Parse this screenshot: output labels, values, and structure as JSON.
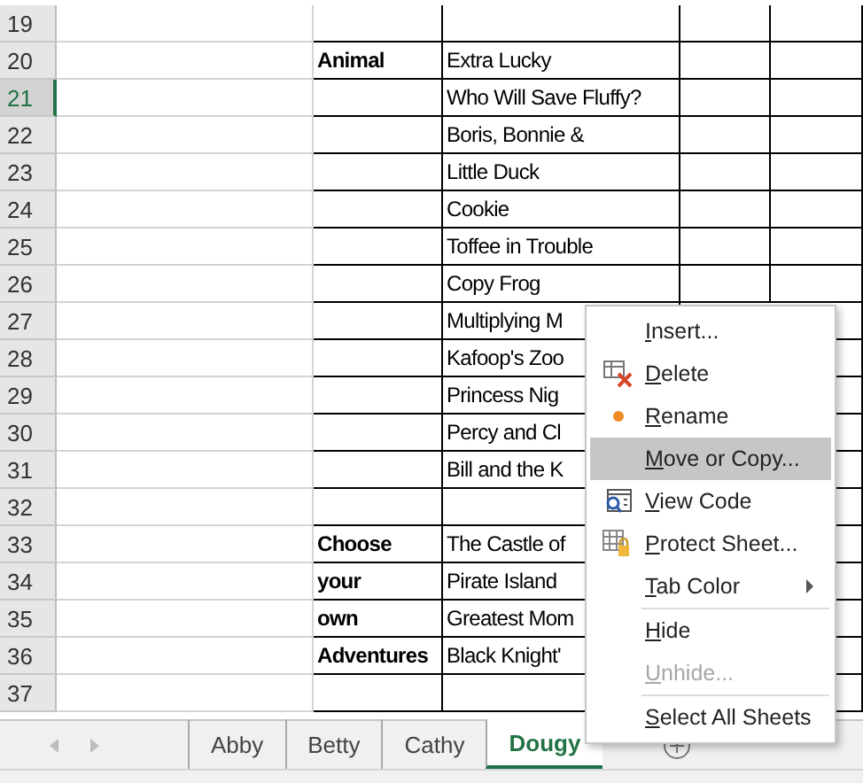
{
  "sheet": {
    "rows": [
      {
        "number": "19",
        "active": false,
        "cells": [
          "",
          "",
          "",
          "",
          ""
        ]
      },
      {
        "number": "20",
        "active": false,
        "cells": [
          "",
          "Animal",
          "Extra Lucky",
          "",
          ""
        ]
      },
      {
        "number": "21",
        "active": true,
        "cells": [
          "",
          "",
          "Who Will Save Fluffy?",
          "",
          ""
        ]
      },
      {
        "number": "22",
        "active": false,
        "cells": [
          "",
          "",
          "Boris, Bonnie &",
          "",
          ""
        ]
      },
      {
        "number": "23",
        "active": false,
        "cells": [
          "",
          "",
          "Little Duck",
          "",
          ""
        ]
      },
      {
        "number": "24",
        "active": false,
        "cells": [
          "",
          "",
          "Cookie",
          "",
          ""
        ]
      },
      {
        "number": "25",
        "active": false,
        "cells": [
          "",
          "",
          "Toffee in Trouble",
          "",
          ""
        ]
      },
      {
        "number": "26",
        "active": false,
        "cells": [
          "",
          "",
          "Copy Frog",
          "",
          ""
        ]
      },
      {
        "number": "27",
        "active": false,
        "cells": [
          "",
          "",
          "Multiplying M",
          "",
          ""
        ]
      },
      {
        "number": "28",
        "active": false,
        "cells": [
          "",
          "",
          "Kafoop's Zoo",
          "",
          ""
        ]
      },
      {
        "number": "29",
        "active": false,
        "cells": [
          "",
          "",
          "Princess Nig",
          "",
          ""
        ]
      },
      {
        "number": "30",
        "active": false,
        "cells": [
          "",
          "",
          "Percy and Cl",
          "",
          ""
        ]
      },
      {
        "number": "31",
        "active": false,
        "cells": [
          "",
          "",
          "Bill and the K",
          "",
          ""
        ]
      },
      {
        "number": "32",
        "active": false,
        "cells": [
          "",
          "",
          "",
          "",
          ""
        ]
      },
      {
        "number": "33",
        "active": false,
        "cells": [
          "",
          "Choose",
          "The Castle of",
          "",
          ""
        ]
      },
      {
        "number": "34",
        "active": false,
        "cells": [
          "",
          "your",
          "Pirate Island",
          "",
          ""
        ]
      },
      {
        "number": "35",
        "active": false,
        "cells": [
          "",
          "own",
          "Greatest Mom",
          "",
          ""
        ]
      },
      {
        "number": "36",
        "active": false,
        "cells": [
          "",
          "Adventures",
          "Black Knight'",
          "",
          ""
        ]
      },
      {
        "number": "37",
        "active": false,
        "cells": [
          "",
          "",
          "",
          "",
          ""
        ]
      }
    ]
  },
  "sheet_tabs": [
    {
      "label": "Abby",
      "selected": false
    },
    {
      "label": "Betty",
      "selected": false
    },
    {
      "label": "Cathy",
      "selected": false
    },
    {
      "label": "Dougy",
      "selected": true
    }
  ],
  "context_menu": [
    {
      "kind": "item",
      "label": "Insert...",
      "highlighted": false,
      "disabled": false
    },
    {
      "kind": "item",
      "label": "Delete",
      "highlighted": false,
      "disabled": false
    },
    {
      "kind": "item",
      "label": "Rename",
      "highlighted": false,
      "disabled": false
    },
    {
      "kind": "item",
      "label": "Move or Copy...",
      "highlighted": true,
      "disabled": false
    },
    {
      "kind": "item",
      "label": "View Code",
      "highlighted": false,
      "disabled": false
    },
    {
      "kind": "item",
      "label": "Protect Sheet...",
      "highlighted": false,
      "disabled": false
    },
    {
      "kind": "submenu",
      "label": "Tab Color",
      "highlighted": false,
      "disabled": false
    },
    {
      "kind": "separator"
    },
    {
      "kind": "item",
      "label": "Hide",
      "highlighted": false,
      "disabled": false
    },
    {
      "kind": "item",
      "label": "Unhide...",
      "highlighted": false,
      "disabled": true
    },
    {
      "kind": "separator"
    },
    {
      "kind": "item",
      "label": "Select All Sheets",
      "highlighted": false,
      "disabled": false
    }
  ]
}
